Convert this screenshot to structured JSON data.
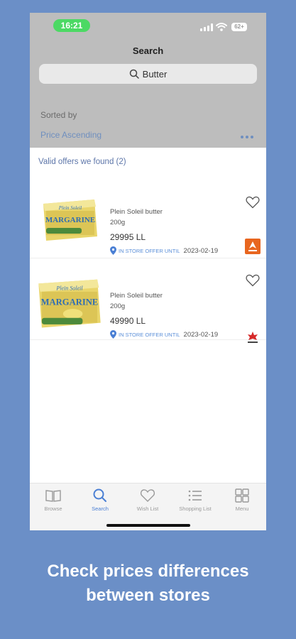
{
  "status_bar": {
    "time": "16:21",
    "battery": "62+"
  },
  "header": {
    "title": "Search"
  },
  "search": {
    "query": "Butter"
  },
  "sort": {
    "label": "Sorted by",
    "value": "Price Ascending"
  },
  "offers": {
    "header": "Valid offers we found (2)",
    "items": [
      {
        "name": "Plein Soleil butter",
        "size": "200g",
        "price": "29995 LL",
        "until_label": "IN STORE OFFER UNTIL",
        "date": "2023-02-19",
        "product_text": [
          "Plein Soleil",
          "MARGARINE"
        ]
      },
      {
        "name": "Plein Soleil butter",
        "size": "200g",
        "price": "49990 LL",
        "until_label": "IN STORE OFFER UNTIL",
        "date": "2023-02-19",
        "product_text": [
          "Plein Soleil",
          "MARGARINE"
        ]
      }
    ]
  },
  "tabs": [
    {
      "label": "Browse",
      "icon": "book-icon"
    },
    {
      "label": "Search",
      "icon": "search-icon"
    },
    {
      "label": "Wish List",
      "icon": "heart-icon"
    },
    {
      "label": "Shopping List",
      "icon": "list-icon"
    },
    {
      "label": "Menu",
      "icon": "grid-icon"
    }
  ],
  "caption": {
    "line1": "Check prices differences",
    "line2": "between stores"
  },
  "colors": {
    "background": "#6b8fc7",
    "header_gray": "#bdbdbd",
    "accent_blue": "#4a7fd4",
    "status_green": "#4cd964",
    "store1_orange": "#e8661f",
    "store2_red": "#d62a2a"
  }
}
